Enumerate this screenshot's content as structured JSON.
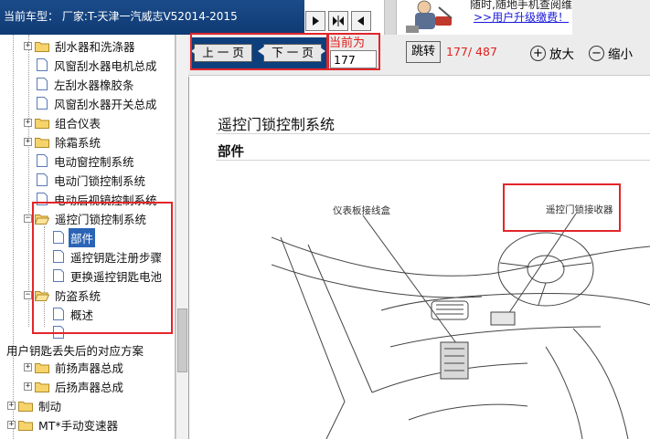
{
  "header": {
    "model_label": "当前车型：",
    "model_value": "厂家:T-天津一汽威志V52014-2015"
  },
  "ad": {
    "line1": "随时,随地手机查阅维修资料",
    "line2": ">>用户升级缴费！"
  },
  "sidebar": {
    "items": [
      {
        "label": "刮水器和洗涤器",
        "type": "folder"
      },
      {
        "label": "风窗刮水器电机总成",
        "type": "doc"
      },
      {
        "label": "左刮水器橡胶条",
        "type": "doc"
      },
      {
        "label": "风窗刮水器开关总成",
        "type": "doc"
      },
      {
        "label": "组合仪表",
        "type": "folder"
      },
      {
        "label": "除霜系统",
        "type": "folder"
      },
      {
        "label": "电动窗控制系统",
        "type": "doc"
      },
      {
        "label": "电动门锁控制系统",
        "type": "doc"
      },
      {
        "label": "电动后视镜控制系统",
        "type": "doc"
      },
      {
        "label": "遥控门锁控制系统",
        "type": "folder-open"
      },
      {
        "label": "部件",
        "type": "doc",
        "selected": true
      },
      {
        "label": "遥控钥匙注册步骤",
        "type": "doc"
      },
      {
        "label": "更换遥控钥匙电池",
        "type": "doc"
      },
      {
        "label": "防盗系统",
        "type": "folder-open"
      },
      {
        "label": "概述",
        "type": "doc"
      },
      {
        "label": "",
        "type": "doc"
      },
      {
        "label": "用户钥匙丢失后的对应方案",
        "type": "text"
      },
      {
        "label": "前扬声器总成",
        "type": "folder"
      },
      {
        "label": "后扬声器总成",
        "type": "folder"
      },
      {
        "label": "制动",
        "type": "folder"
      },
      {
        "label": "MT*手动变速器",
        "type": "folder"
      }
    ]
  },
  "toolbar": {
    "prev": "上 一 页",
    "next": "下 一 页",
    "current_label": "当前为",
    "current_page": "177",
    "jump": "跳转",
    "page_count": "177/ 487",
    "zoom_in": "放大",
    "zoom_out": "缩小"
  },
  "document": {
    "title": "遥控门锁控制系统",
    "subtitle": "部件",
    "callout_left": "仪表板接线盒",
    "callout_right": "遥控门锁接收器"
  },
  "colors": {
    "header_blue": "#1b4c8a",
    "pager_blue": "#0d3f7c",
    "highlight_red": "#e2262a",
    "selection_blue": "#2b64b6"
  }
}
